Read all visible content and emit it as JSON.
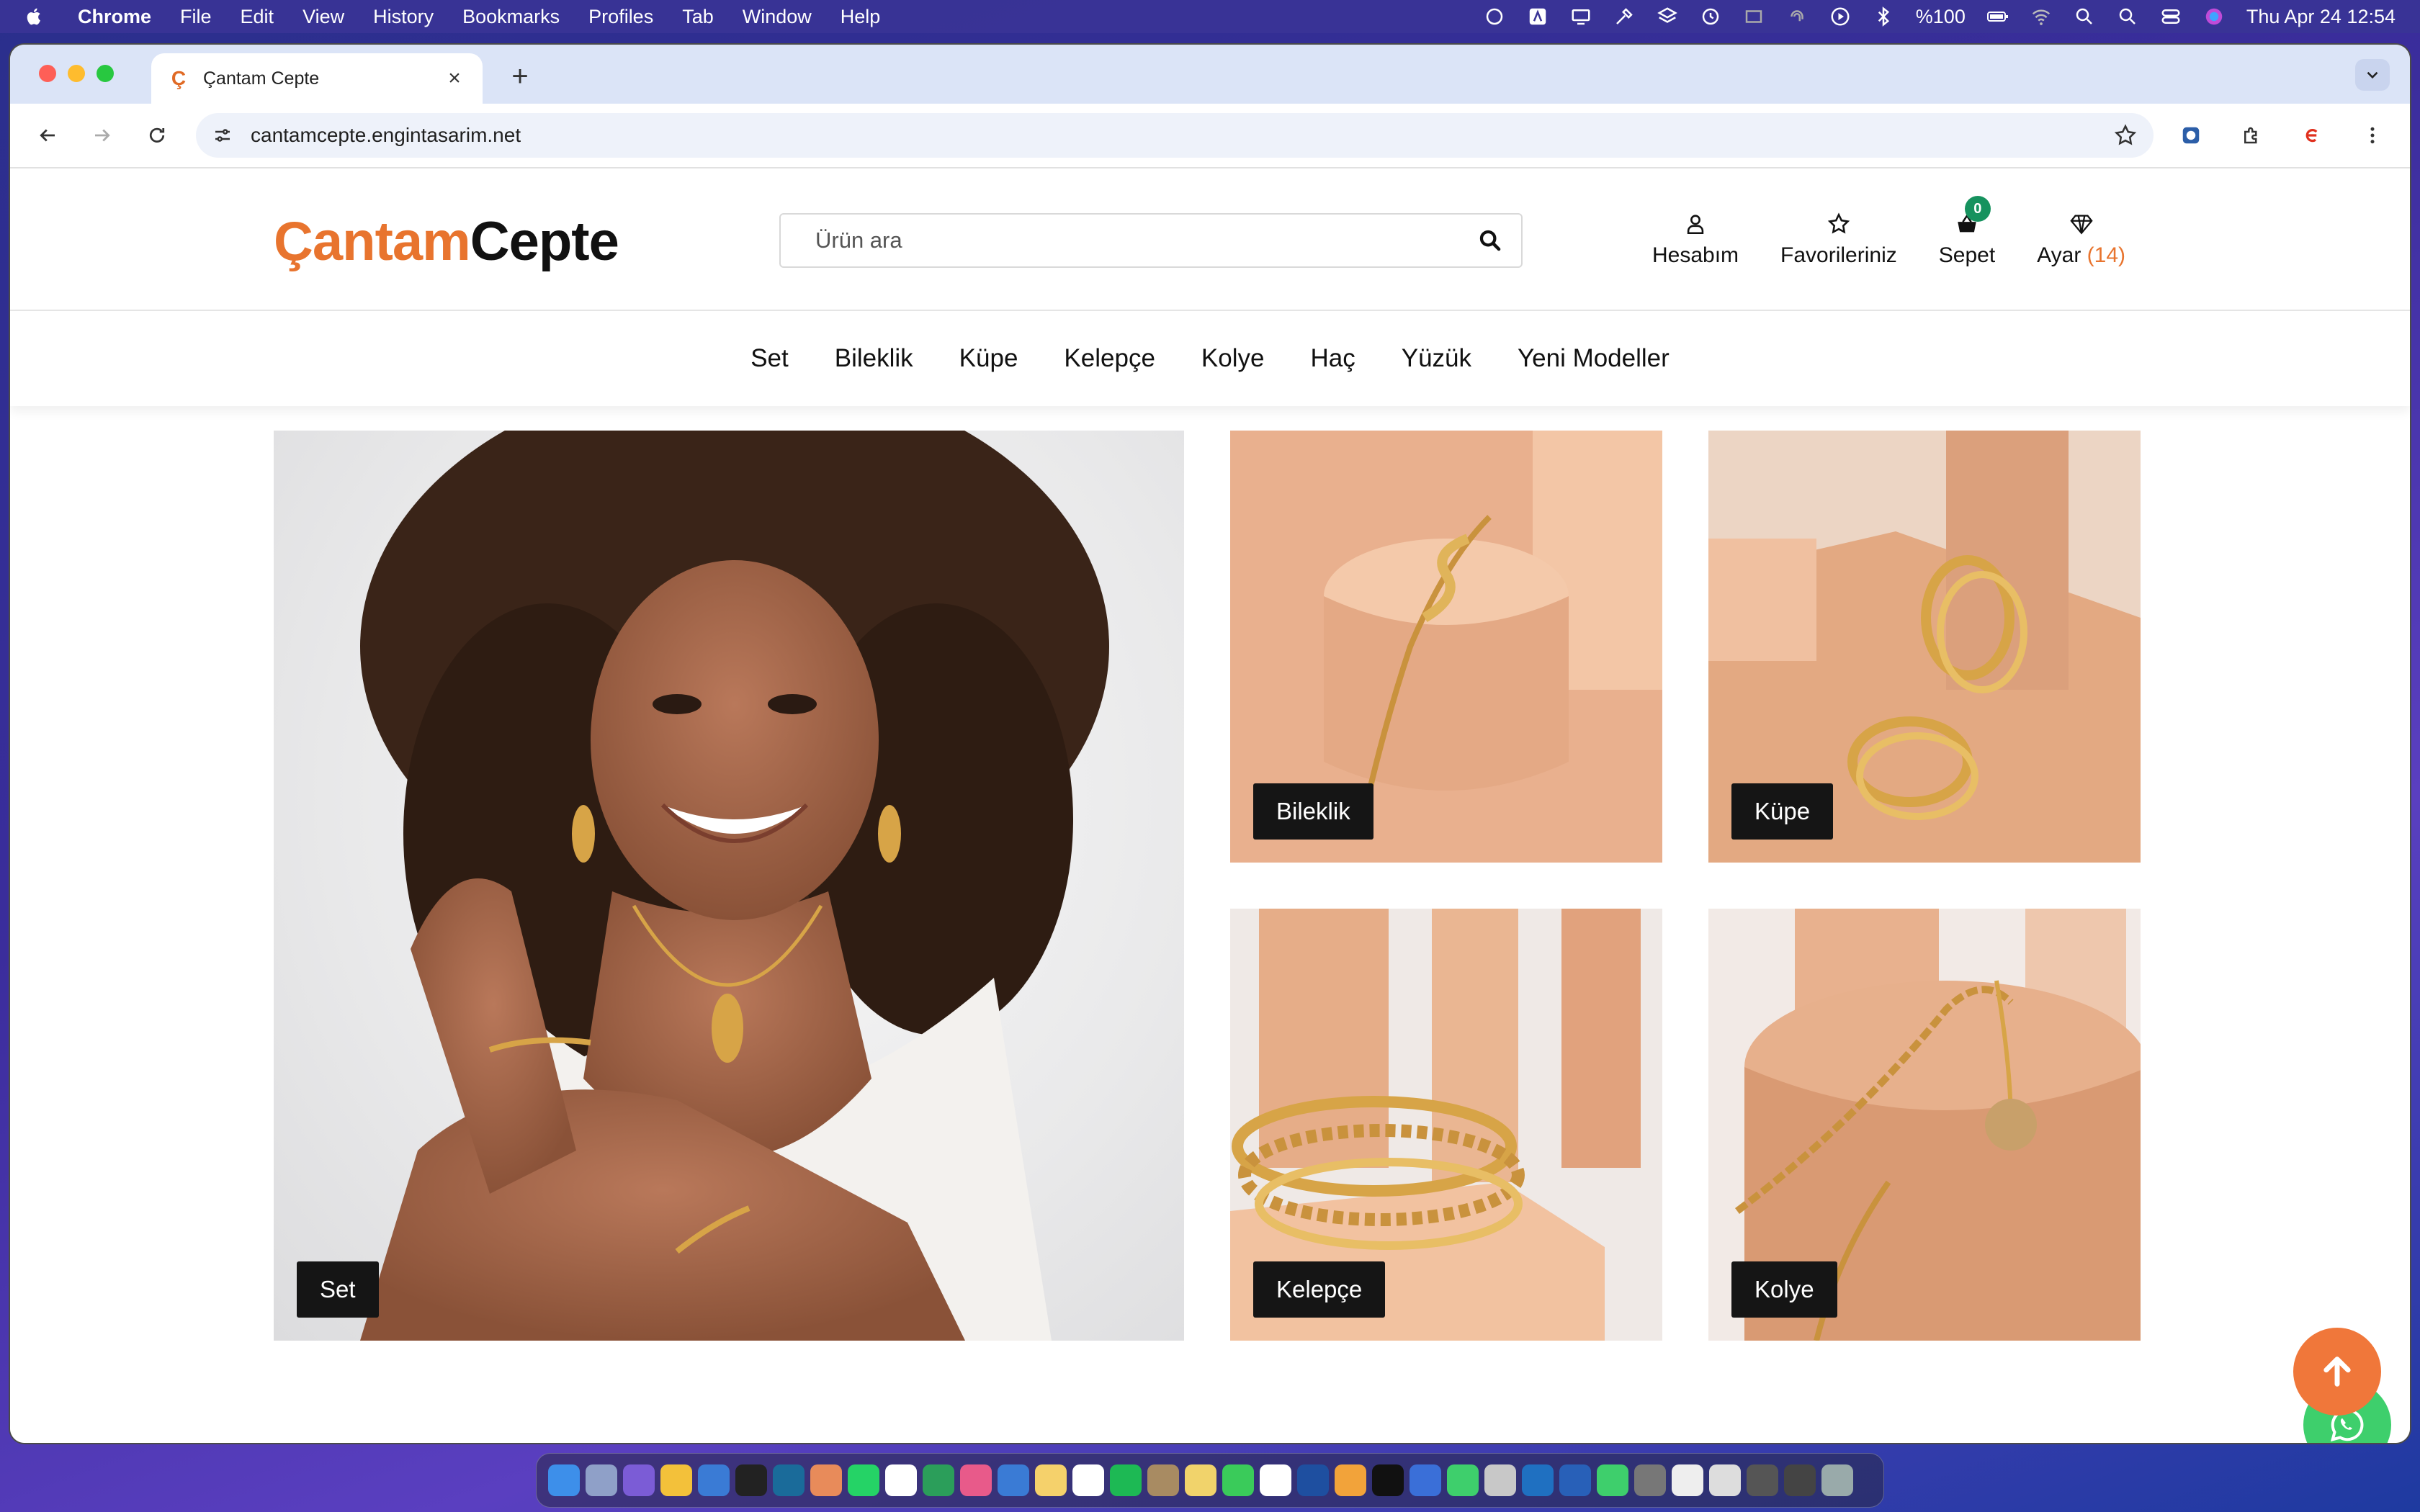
{
  "menubar": {
    "app": "Chrome",
    "items": [
      "File",
      "Edit",
      "View",
      "History",
      "Bookmarks",
      "Profiles",
      "Tab",
      "Window",
      "Help"
    ],
    "battery": "%100",
    "clock": "Thu Apr 24  12:54"
  },
  "browser": {
    "tab_title": "Çantam Cepte",
    "url": "cantamcepte.engintasarim.net"
  },
  "site": {
    "logo_part1": "Çantam",
    "logo_part2": "Cepte",
    "search_placeholder": "Ürün ara",
    "account_label": "Hesabım",
    "favorites_label": "Favorileriniz",
    "cart_label": "Sepet",
    "cart_count": "0",
    "carat_label": "Ayar",
    "carat_count": "(14)",
    "nav": [
      "Set",
      "Bileklik",
      "Küpe",
      "Kelepçe",
      "Kolye",
      "Haç",
      "Yüzük",
      "Yeni Modeller"
    ],
    "tiles": {
      "set": "Set",
      "bileklik": "Bileklik",
      "kupe": "Küpe",
      "kelepce": "Kelepçe",
      "kolye": "Kolye"
    }
  },
  "colors": {
    "brand_orange": "#e8742e",
    "badge_green": "#16925e",
    "whatsapp_green": "#3ecf6c"
  }
}
